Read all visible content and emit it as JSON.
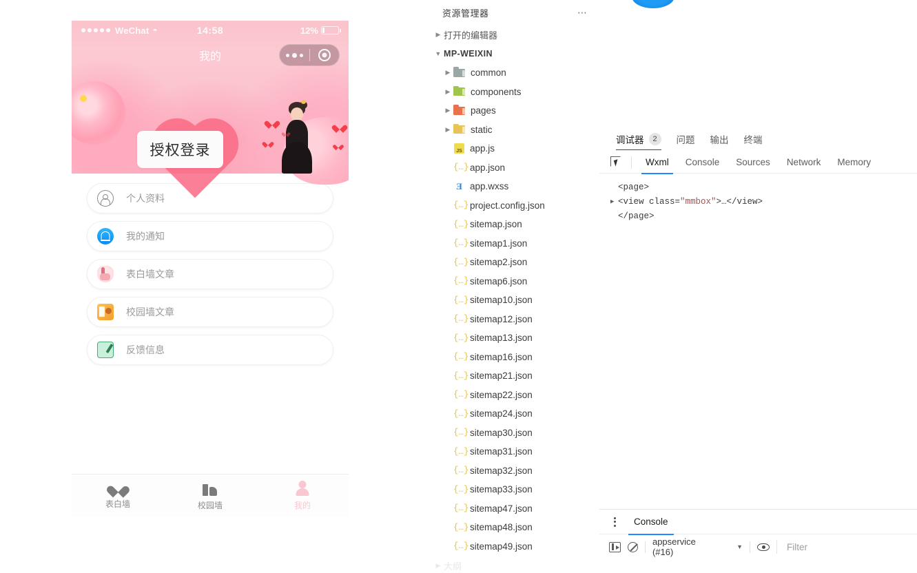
{
  "simulator": {
    "status_bar": {
      "carrier": "WeChat",
      "wifi_icon": "wifi-icon",
      "time": "14:58",
      "battery_percent": "12%",
      "battery_icon": "battery-icon"
    },
    "nav": {
      "title": "我的",
      "capsule_more_icon": "more-dots-icon",
      "capsule_target_icon": "target-circle-icon"
    },
    "hero": {
      "auth_button": "授权登录"
    },
    "list": [
      {
        "icon": "person-circle-icon",
        "label": "个人资料"
      },
      {
        "icon": "bell-icon",
        "label": "我的通知"
      },
      {
        "icon": "hand-icon",
        "label": "表白墙文章"
      },
      {
        "icon": "board-icon",
        "label": "校园墙文章"
      },
      {
        "icon": "edit-icon",
        "label": "反馈信息"
      }
    ],
    "tabbar": [
      {
        "icon": "heart-icon",
        "label": "表白墙",
        "active": false
      },
      {
        "icon": "school-icon",
        "label": "校园墙",
        "active": false
      },
      {
        "icon": "user-icon",
        "label": "我的",
        "active": true
      }
    ],
    "active_tab_color": "#f9c8d2"
  },
  "explorer": {
    "title": "资源管理器",
    "more_icon": "ellipsis-icon",
    "open_editors": "打开的编辑器",
    "project_root": "MP-WEIXIN",
    "outline": "大纲",
    "folders": [
      {
        "name": "common",
        "icon": "folder-icon",
        "color": "#9aa7a6"
      },
      {
        "name": "components",
        "icon": "folder-icon",
        "color": "#9fc54d"
      },
      {
        "name": "pages",
        "icon": "folder-icon",
        "color": "#e8734a"
      },
      {
        "name": "static",
        "icon": "folder-icon",
        "color": "#e8c35a"
      }
    ],
    "files": [
      {
        "name": "app.js",
        "icon": "js-file-icon"
      },
      {
        "name": "app.json",
        "icon": "json-file-icon"
      },
      {
        "name": "app.wxss",
        "icon": "css-file-icon"
      },
      {
        "name": "project.config.json",
        "icon": "json-file-icon"
      },
      {
        "name": "sitemap.json",
        "icon": "json-file-icon"
      },
      {
        "name": "sitemap1.json",
        "icon": "json-file-icon"
      },
      {
        "name": "sitemap2.json",
        "icon": "json-file-icon"
      },
      {
        "name": "sitemap6.json",
        "icon": "json-file-icon"
      },
      {
        "name": "sitemap10.json",
        "icon": "json-file-icon"
      },
      {
        "name": "sitemap12.json",
        "icon": "json-file-icon"
      },
      {
        "name": "sitemap13.json",
        "icon": "json-file-icon"
      },
      {
        "name": "sitemap16.json",
        "icon": "json-file-icon"
      },
      {
        "name": "sitemap21.json",
        "icon": "json-file-icon"
      },
      {
        "name": "sitemap22.json",
        "icon": "json-file-icon"
      },
      {
        "name": "sitemap24.json",
        "icon": "json-file-icon"
      },
      {
        "name": "sitemap30.json",
        "icon": "json-file-icon"
      },
      {
        "name": "sitemap31.json",
        "icon": "json-file-icon"
      },
      {
        "name": "sitemap32.json",
        "icon": "json-file-icon"
      },
      {
        "name": "sitemap33.json",
        "icon": "json-file-icon"
      },
      {
        "name": "sitemap47.json",
        "icon": "json-file-icon"
      },
      {
        "name": "sitemap48.json",
        "icon": "json-file-icon"
      },
      {
        "name": "sitemap49.json",
        "icon": "json-file-icon"
      }
    ]
  },
  "devtools": {
    "panel_tabs": [
      {
        "label": "调试器",
        "badge": "2",
        "active": true
      },
      {
        "label": "问题",
        "badge": "",
        "active": false
      },
      {
        "label": "输出",
        "badge": "",
        "active": false
      },
      {
        "label": "终端",
        "badge": "",
        "active": false
      }
    ],
    "inspect_icon": "inspect-cursor-icon",
    "devtool_tabs": [
      {
        "label": "Wxml",
        "active": true
      },
      {
        "label": "Console",
        "active": false
      },
      {
        "label": "Sources",
        "active": false
      },
      {
        "label": "Network",
        "active": false
      },
      {
        "label": "Memory",
        "active": false
      }
    ],
    "active_tab_color": "#1a8cff",
    "wxml": {
      "line1": "<page>",
      "line2_open": "<view class=",
      "line2_value": "\"mmbox\"",
      "line2_close": ">…</view>",
      "line3": "</page>",
      "expand_arrow_icon": "chevron-right-icon"
    },
    "console": {
      "kebab_icon": "kebab-menu-icon",
      "tab_label": "Console",
      "drawer_icon": "show-drawer-icon",
      "clear_icon": "clear-console-icon",
      "source": "appservice (#16)",
      "source_caret_icon": "chevron-down-icon",
      "eye_icon": "eye-icon",
      "filter_placeholder": "Filter",
      "filter_value": ""
    }
  }
}
